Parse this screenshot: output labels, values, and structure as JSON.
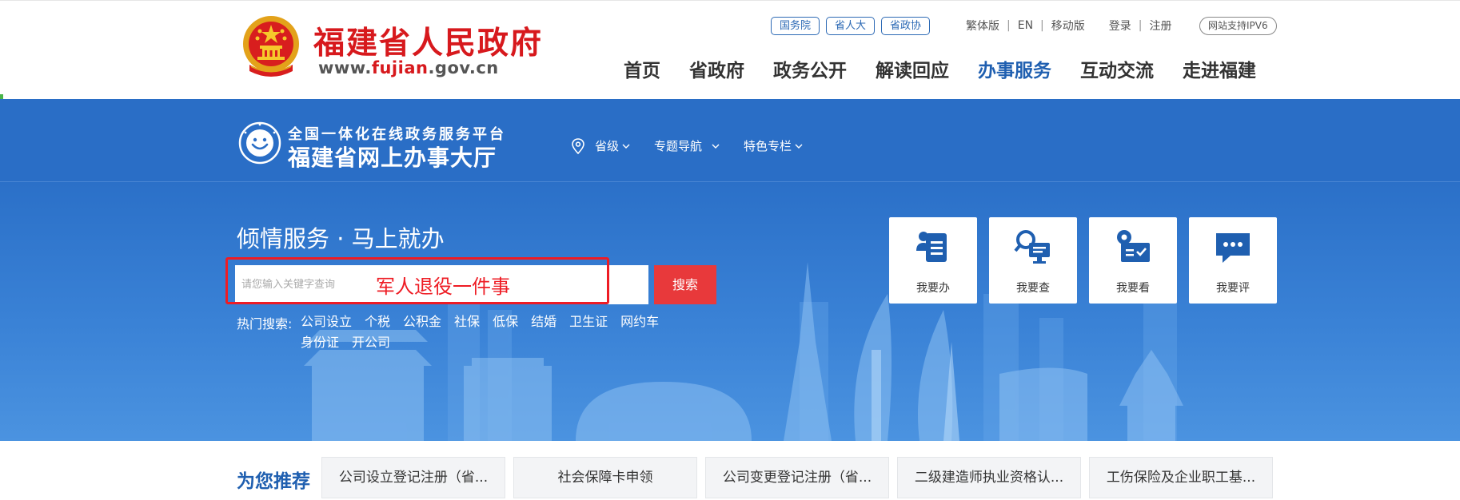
{
  "header": {
    "site_title": "福建省人民政府",
    "url_prefix": "www.",
    "url_highlight": "fujian",
    "url_suffix": ".gov.cn",
    "org_links": [
      "国务院",
      "省人大",
      "省政协"
    ],
    "util_links": [
      "繁体版",
      "EN",
      "移动版"
    ],
    "auth_links": [
      "登录",
      "注册"
    ],
    "ipv6_badge": "网站支持IPV6",
    "nav": [
      "首页",
      "省政府",
      "政务公开",
      "解读回应",
      "办事服务",
      "互动交流",
      "走进福建"
    ],
    "active_nav": "办事服务"
  },
  "hall": {
    "subtitle": "全国一体化在线政务服务平台",
    "title": "福建省网上办事大厅",
    "nav": [
      "省级",
      "专题导航",
      "特色专栏"
    ]
  },
  "hero": {
    "slogan": "倾情服务 · 马上就办",
    "search_placeholder": "请您输入关键字查询",
    "annotation_text": "军人退役一件事",
    "search_button": "搜索",
    "hot_label": "热门搜索:",
    "hot_items": [
      "公司设立",
      "个税",
      "公积金",
      "社保",
      "低保",
      "结婚",
      "卫生证",
      "网约车",
      "身份证",
      "开公司"
    ],
    "service_cards": [
      "我要办",
      "我要查",
      "我要看",
      "我要评"
    ]
  },
  "recommend": {
    "title": "为您推荐",
    "items": [
      "公司设立登记注册（省...",
      "社会保障卡申领",
      "公司变更登记注册（省...",
      "二级建造师执业资格认...",
      "工伤保险及企业职工基..."
    ]
  },
  "colors": {
    "brand_red": "#d7191d",
    "brand_blue": "#1f5fb0",
    "hall_blue": "#2a6ec6",
    "search_red": "#e8393b",
    "annotation_red": "#ee1c24"
  }
}
